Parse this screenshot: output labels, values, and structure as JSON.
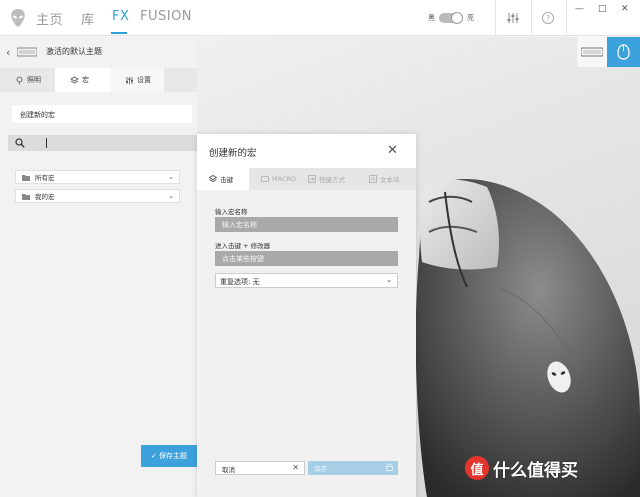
{
  "nav": {
    "home": "主页",
    "library": "库",
    "fx": "FX",
    "fusion": "FUSION"
  },
  "theme": {
    "dark_label": "黑",
    "light_label": "亮"
  },
  "window_controls": {
    "minimize": "—",
    "maximize": "□",
    "close": "✕"
  },
  "left_panel": {
    "back": "‹",
    "title": "激活的默认主题",
    "tabs": [
      "照明",
      "宏",
      "设置"
    ],
    "create_macro": "创建新的宏",
    "search_placeholder": "",
    "folders": [
      "所有宏",
      "我的宏"
    ],
    "save_theme": "✓ 保存主题"
  },
  "dialog": {
    "title": "创建新的宏",
    "close": "✕",
    "tabs": [
      "击键",
      "MACRO",
      "快捷方式",
      "文本块"
    ],
    "name_label": "输入宏名称",
    "name_placeholder": "输入宏名称",
    "keystroke_label": "进入击键 + 修改器",
    "keystroke_placeholder": "点击某些按键",
    "repeat_option": "重复选项: 无",
    "cancel": "取消",
    "save": "保存"
  },
  "watermark": {
    "badge": "值",
    "text": "什么值得买"
  },
  "colors": {
    "accent": "#2aa1d7",
    "save_button": "#3da2dc"
  }
}
